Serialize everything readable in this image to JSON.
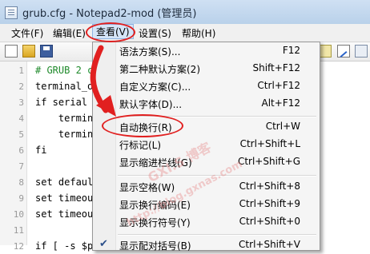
{
  "window": {
    "title": "grub.cfg - Notepad2-mod (管理员)"
  },
  "menubar": {
    "items": [
      {
        "label": "文件(F)"
      },
      {
        "label": "编辑(E)"
      },
      {
        "label": "查看(V)"
      },
      {
        "label": "设置(S)"
      },
      {
        "label": "帮助(H)"
      }
    ]
  },
  "editor": {
    "line_numbers": [
      "1",
      "2",
      "3",
      "4",
      "5",
      "6",
      "7",
      "8",
      "9",
      "10",
      "11",
      "12"
    ],
    "lines": [
      "# GRUB 2 c",
      "terminal_o",
      "if serial",
      "    termin",
      "    termin",
      "fi",
      "",
      "set defaul",
      "set timeou",
      "set timeou",
      "",
      "if [ -s $p"
    ]
  },
  "view_menu": {
    "items": [
      {
        "label": "语法方案(S)...",
        "accel": "F12"
      },
      {
        "label": "第二种默认方案(2)",
        "accel": "Shift+F12"
      },
      {
        "label": "自定义方案(C)...",
        "accel": "Ctrl+F12"
      },
      {
        "label": "默认字体(D)...",
        "accel": "Alt+F12"
      },
      {
        "label": "自动换行(R)",
        "accel": "Ctrl+W"
      },
      {
        "label": "行标记(L)",
        "accel": "Ctrl+Shift+L"
      },
      {
        "label": "显示缩进栏线(G)",
        "accel": "Ctrl+Shift+G"
      },
      {
        "label": "显示空格(W)",
        "accel": "Ctrl+Shift+8"
      },
      {
        "label": "显示换行编码(E)",
        "accel": "Ctrl+Shift+9"
      },
      {
        "label": "显示换行符号(Y)",
        "accel": "Ctrl+Shift+0"
      },
      {
        "label": "显示配对括号(B)",
        "accel": "Ctrl+Shift+V"
      }
    ]
  },
  "watermark": {
    "text1": "GXI.S 博客",
    "text2": "http://blog.gxnas.com"
  },
  "colors": {
    "annotation_red": "#e12020",
    "comment_green": "#1f8a2b"
  }
}
